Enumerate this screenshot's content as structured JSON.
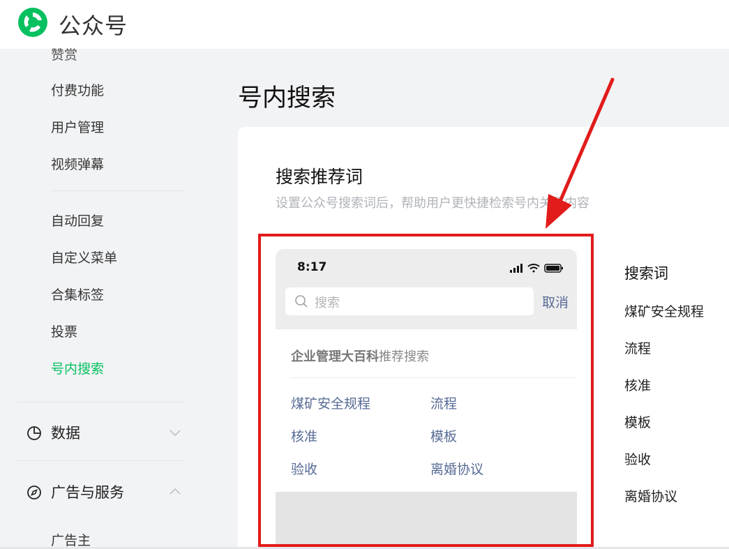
{
  "header": {
    "brand": "公众号",
    "brand_color": "#07c160"
  },
  "sidebar": {
    "items": [
      {
        "label": "赞赏"
      },
      {
        "label": "付费功能"
      },
      {
        "label": "用户管理"
      },
      {
        "label": "视频弹幕"
      },
      {
        "label": "自动回复"
      },
      {
        "label": "自定义菜单"
      },
      {
        "label": "合集标签"
      },
      {
        "label": "投票"
      },
      {
        "label": "号内搜索",
        "active": true
      }
    ],
    "groups": [
      {
        "label": "数据",
        "icon": "pie-chart-icon",
        "expanded": false
      },
      {
        "label": "广告与服务",
        "icon": "compass-icon",
        "expanded": true
      }
    ],
    "sub_items": [
      {
        "label": "广告主"
      }
    ]
  },
  "main": {
    "page_title": "号内搜索",
    "section": {
      "title": "搜索推荐词",
      "description": "设置公众号搜索词后，帮助用户更快捷检索号内关联内容"
    },
    "phone_preview": {
      "time": "8:17",
      "search_placeholder": "搜索",
      "cancel_label": "取消",
      "account_name": "企业管理大百科",
      "recommend_suffix": "推荐搜索",
      "keywords": [
        "煤矿安全规程",
        "流程",
        "核准",
        "模板",
        "验收",
        "离婚协议"
      ]
    },
    "keyword_list": {
      "title": "搜索词",
      "items": [
        "煤矿安全规程",
        "流程",
        "核准",
        "模板",
        "验收",
        "离婚协议"
      ]
    }
  },
  "annotation": {
    "highlight_color": "#e21b1b"
  }
}
